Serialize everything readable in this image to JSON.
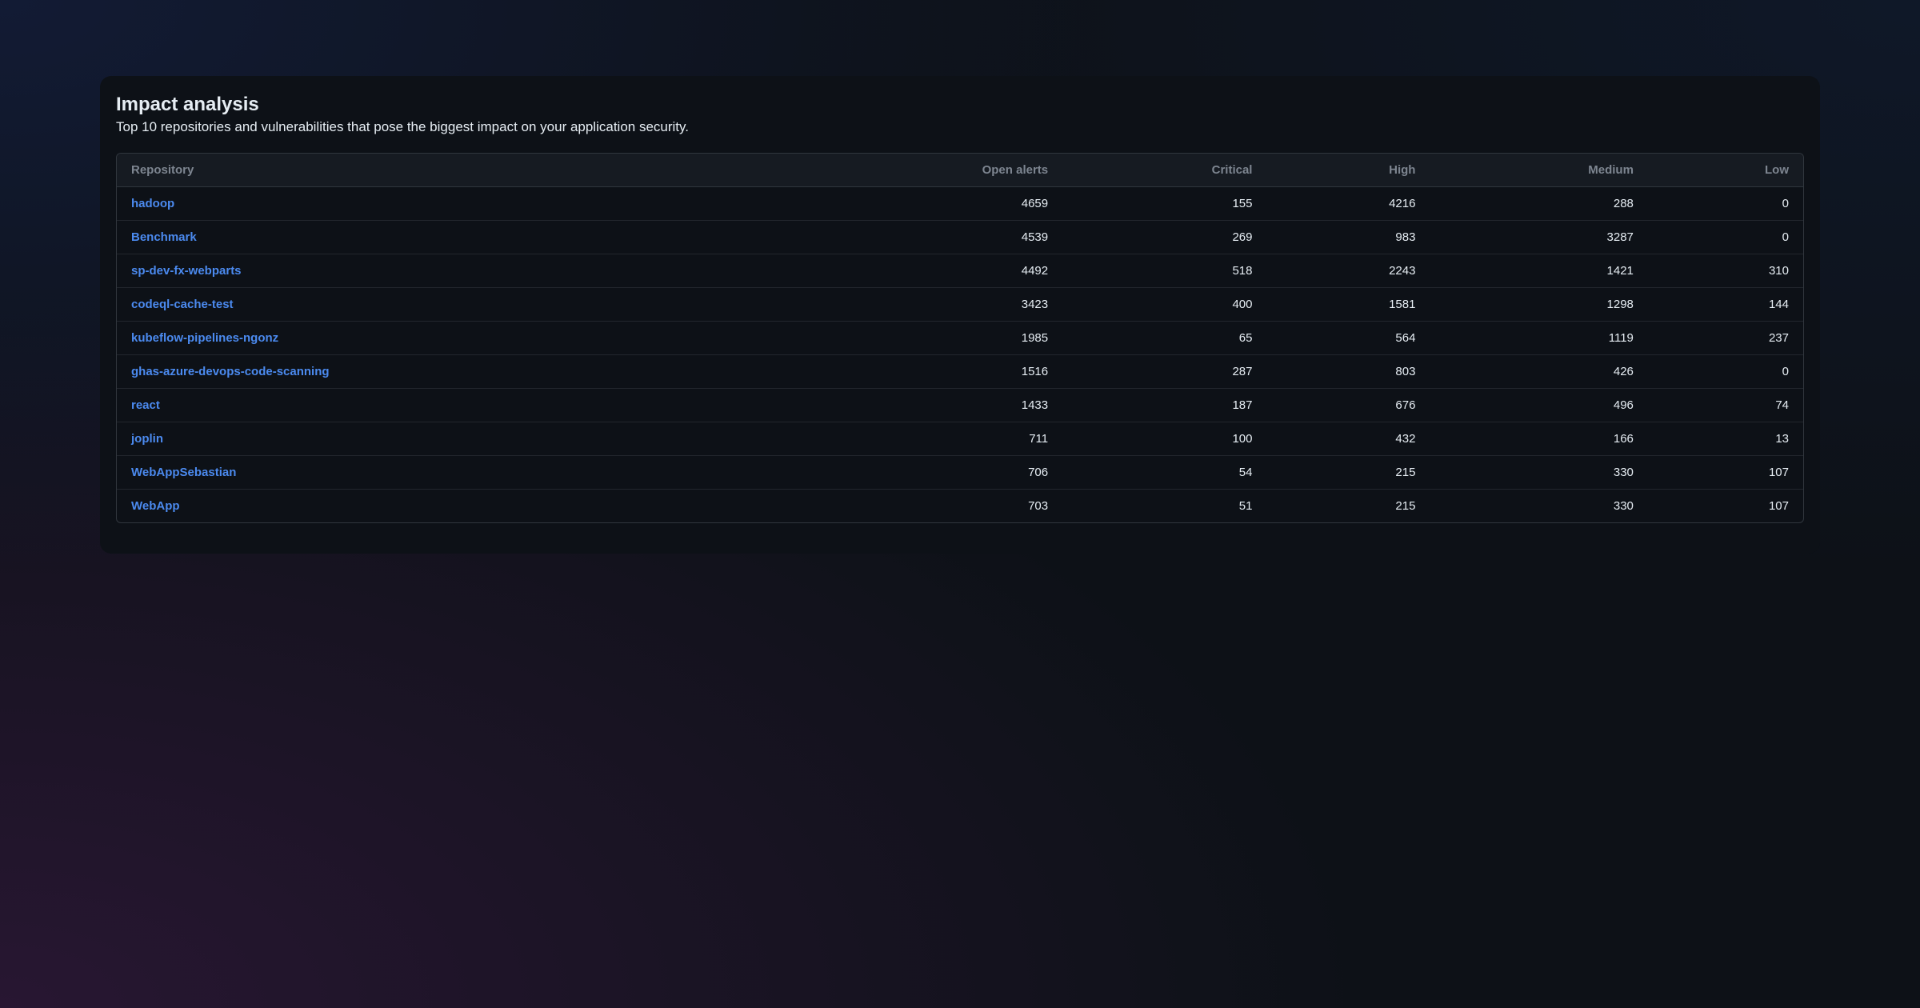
{
  "header": {
    "title": "Impact analysis",
    "subtitle": "Top 10 repositories and vulnerabilities that pose the biggest impact on your application security."
  },
  "table": {
    "columns": {
      "repository": "Repository",
      "open_alerts": "Open alerts",
      "critical": "Critical",
      "high": "High",
      "medium": "Medium",
      "low": "Low"
    },
    "rows": [
      {
        "repository": "hadoop",
        "open_alerts": "4659",
        "critical": "155",
        "high": "4216",
        "medium": "288",
        "low": "0"
      },
      {
        "repository": "Benchmark",
        "open_alerts": "4539",
        "critical": "269",
        "high": "983",
        "medium": "3287",
        "low": "0"
      },
      {
        "repository": "sp-dev-fx-webparts",
        "open_alerts": "4492",
        "critical": "518",
        "high": "2243",
        "medium": "1421",
        "low": "310"
      },
      {
        "repository": "codeql-cache-test",
        "open_alerts": "3423",
        "critical": "400",
        "high": "1581",
        "medium": "1298",
        "low": "144"
      },
      {
        "repository": "kubeflow-pipelines-ngonz",
        "open_alerts": "1985",
        "critical": "65",
        "high": "564",
        "medium": "1119",
        "low": "237"
      },
      {
        "repository": "ghas-azure-devops-code-scanning",
        "open_alerts": "1516",
        "critical": "287",
        "high": "803",
        "medium": "426",
        "low": "0"
      },
      {
        "repository": "react",
        "open_alerts": "1433",
        "critical": "187",
        "high": "676",
        "medium": "496",
        "low": "74"
      },
      {
        "repository": "joplin",
        "open_alerts": "711",
        "critical": "100",
        "high": "432",
        "medium": "166",
        "low": "13"
      },
      {
        "repository": "WebAppSebastian",
        "open_alerts": "706",
        "critical": "54",
        "high": "215",
        "medium": "330",
        "low": "107"
      },
      {
        "repository": "WebApp",
        "open_alerts": "703",
        "critical": "51",
        "high": "215",
        "medium": "330",
        "low": "107"
      }
    ]
  }
}
